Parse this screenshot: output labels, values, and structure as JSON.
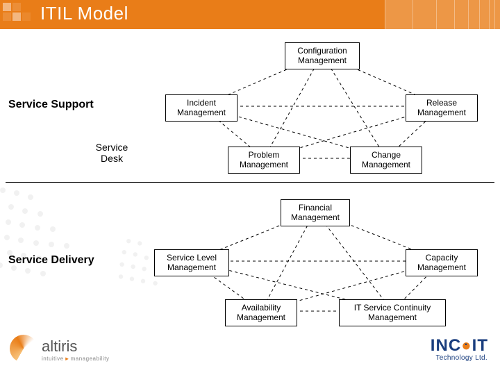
{
  "title": "ITIL Model",
  "sections": {
    "support_label": "Service Support",
    "desk_label_l1": "Service",
    "desk_label_l2": "Desk",
    "delivery_label": "Service Delivery"
  },
  "support_nodes": {
    "config_l1": "Configuration",
    "config_l2": "Management",
    "incident_l1": "Incident",
    "incident_l2": "Management",
    "release_l1": "Release",
    "release_l2": "Management",
    "problem_l1": "Problem",
    "problem_l2": "Management",
    "change_l1": "Change",
    "change_l2": "Management"
  },
  "delivery_nodes": {
    "financial_l1": "Financial",
    "financial_l2": "Management",
    "sl_l1": "Service Level",
    "sl_l2": "Management",
    "capacity_l1": "Capacity",
    "capacity_l2": "Management",
    "availability_l1": "Availability",
    "availability_l2": "Management",
    "continuity_l1": "IT Service Continuity",
    "continuity_l2": "Management"
  },
  "logos": {
    "altiris_word": "altiris",
    "altiris_tag_left": "intuitive",
    "altiris_tag_right": "manageability",
    "incit_I": "I",
    "incit_N": "N",
    "incit_C": "C",
    "incit_dot": "●",
    "incit_I2": "I",
    "incit_T": "T",
    "incit_sub": "Technology Ltd."
  },
  "colors": {
    "accent": "#e97d18",
    "navy": "#1a3e7e"
  }
}
